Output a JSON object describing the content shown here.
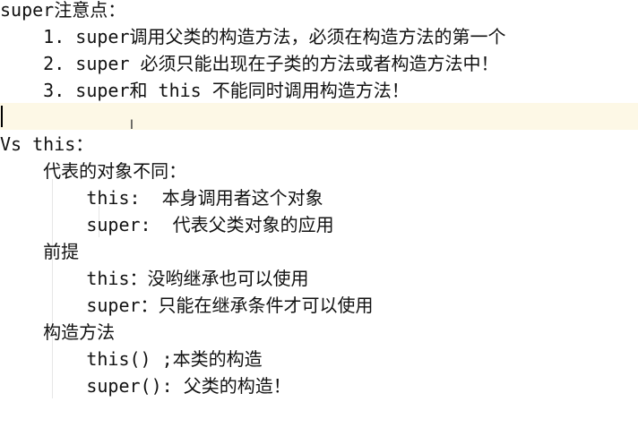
{
  "lines": [
    "super注意点：",
    "    1. super调用父类的构造方法，必须在构造方法的第一个",
    "    2. super 必须只能出现在子类的方法或者构造方法中！",
    "    3. super和 this 不能同时调用构造方法！",
    "",
    "Vs this：",
    "    代表的对象不同：",
    "        this:  本身调用者这个对象",
    "        super:  代表父类对象的应用",
    "    前提",
    "        this：没哟继承也可以使用",
    "        super：只能在继承条件才可以使用",
    "    构造方法",
    "        this() ;本类的构造",
    "        super(): 父类的构造！"
  ],
  "colors": {
    "background": "#ffffff",
    "current_line": "#fdf8e6",
    "text": "#111111"
  },
  "icons": {
    "mouse_cursor": "text-ibeam-cursor",
    "ibeam_glyph": "I"
  }
}
